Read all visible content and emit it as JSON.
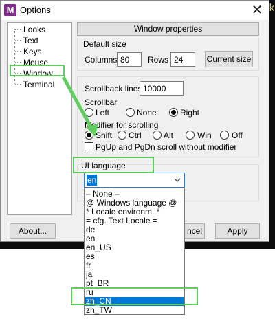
{
  "background_terminal": {
    "text": "k"
  },
  "window": {
    "icon_letter": "M",
    "title": "Options",
    "close_glyph": "✕"
  },
  "tree": {
    "items": [
      {
        "label": "Looks"
      },
      {
        "label": "Text"
      },
      {
        "label": "Keys"
      },
      {
        "label": "Mouse"
      },
      {
        "label": "Window"
      },
      {
        "label": "Terminal"
      }
    ],
    "selected": "Window"
  },
  "header_button": "Window properties",
  "default_size": {
    "title": "Default size",
    "columns_label": "Columns",
    "columns_value": "80",
    "rows_label": "Rows",
    "rows_value": "24",
    "current_size_button": "Current size"
  },
  "scroll": {
    "scrollback_label": "Scrollback lines",
    "scrollback_value": "10000",
    "scrollbar_title": "Scrollbar",
    "scrollbar_options": [
      "Left",
      "None",
      "Right"
    ],
    "scrollbar_selected": "Right",
    "modifier_title": "Modifier for scrolling",
    "modifier_options": [
      "Shift",
      "Ctrl",
      "Alt",
      "Win",
      "Off"
    ],
    "modifier_selected": "Shift",
    "pgup_label": "PgUp and PgDn scroll without modifier",
    "pgup_checked": false
  },
  "ui_language": {
    "title": "UI language",
    "selected_value": "en",
    "options": [
      "– None –",
      "@ Windows language @",
      "* Locale environm. *",
      "= cfg. Text Locale =",
      "de",
      "en",
      "en_US",
      "es",
      "fr",
      "ja",
      "pt_BR",
      "ru",
      "zh_CN",
      "zh_TW"
    ],
    "highlighted": "zh_CN"
  },
  "footer": {
    "about_button": "About...",
    "cancel_button_partial": "ncel",
    "apply_button": "Apply"
  },
  "colors": {
    "annotation": "#5fce5f",
    "selection": "#0078d7",
    "app_icon": "#7b2d86"
  }
}
